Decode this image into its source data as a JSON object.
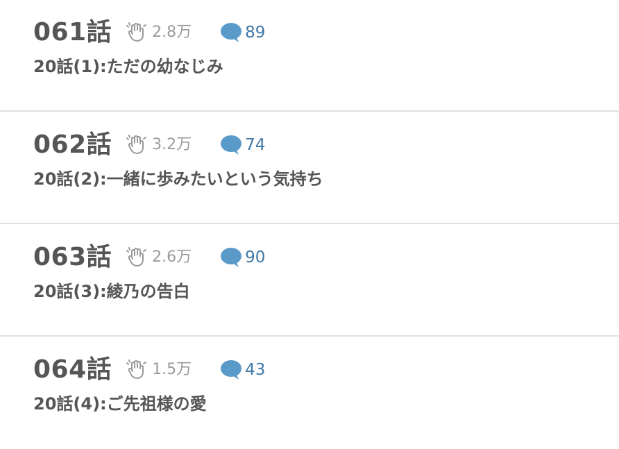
{
  "episodes": [
    {
      "number": "061話",
      "claps": "2.8万",
      "comments": "89",
      "title": "20話(1):ただの幼なじみ"
    },
    {
      "number": "062話",
      "claps": "3.2万",
      "comments": "74",
      "title": "20話(2):一緒に歩みたいという気持ち"
    },
    {
      "number": "063話",
      "claps": "2.6万",
      "comments": "90",
      "title": "20話(3):綾乃の告白"
    },
    {
      "number": "064話",
      "claps": "1.5万",
      "comments": "43",
      "title": "20話(4):ご先祖様の愛"
    }
  ],
  "icons": {
    "clap": "clap-icon",
    "comment": "comment-bubble-icon"
  },
  "colors": {
    "text": "#555555",
    "clap_text": "#9a9a9a",
    "comment_icon": "#5a9ac8",
    "comment_text": "#3f78a8",
    "divider": "#e1e1e1"
  }
}
